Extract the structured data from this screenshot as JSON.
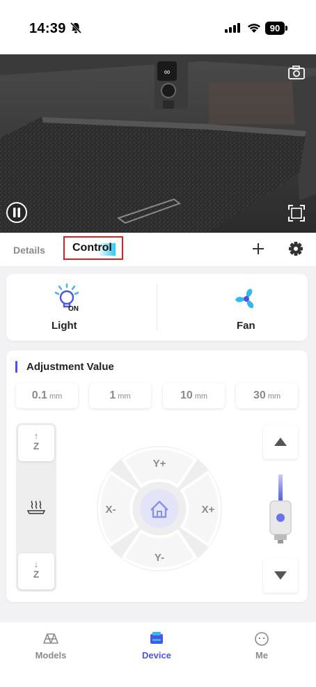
{
  "status_bar": {
    "time": "14:39",
    "battery": "90"
  },
  "camera": {
    "icons": [
      "camera-switch-icon",
      "pause-icon",
      "fullscreen-icon"
    ]
  },
  "tabs": {
    "details": "Details",
    "control": "Control"
  },
  "toolbar": {
    "add_icon": "plus-icon",
    "settings_icon": "gear-icon"
  },
  "controls": {
    "light": {
      "label": "Light",
      "badge": "ON"
    },
    "fan": {
      "label": "Fan"
    }
  },
  "adjustment": {
    "title": "Adjustment Value",
    "steps": [
      {
        "value": "0.1",
        "unit": "mm"
      },
      {
        "value": "1",
        "unit": "mm"
      },
      {
        "value": "10",
        "unit": "mm"
      },
      {
        "value": "30",
        "unit": "mm"
      }
    ],
    "z_up_label": "Z",
    "z_down_label": "Z",
    "dpad": {
      "up": "Y+",
      "down": "Y-",
      "left": "X-",
      "right": "X+"
    }
  },
  "nav": {
    "models": "Models",
    "device": "Device",
    "me": "Me"
  },
  "colors": {
    "accent": "#4a55e8",
    "highlight_border": "#e0201a",
    "tab_gradient": "#33c9f0",
    "muted": "#8a8a8a"
  }
}
